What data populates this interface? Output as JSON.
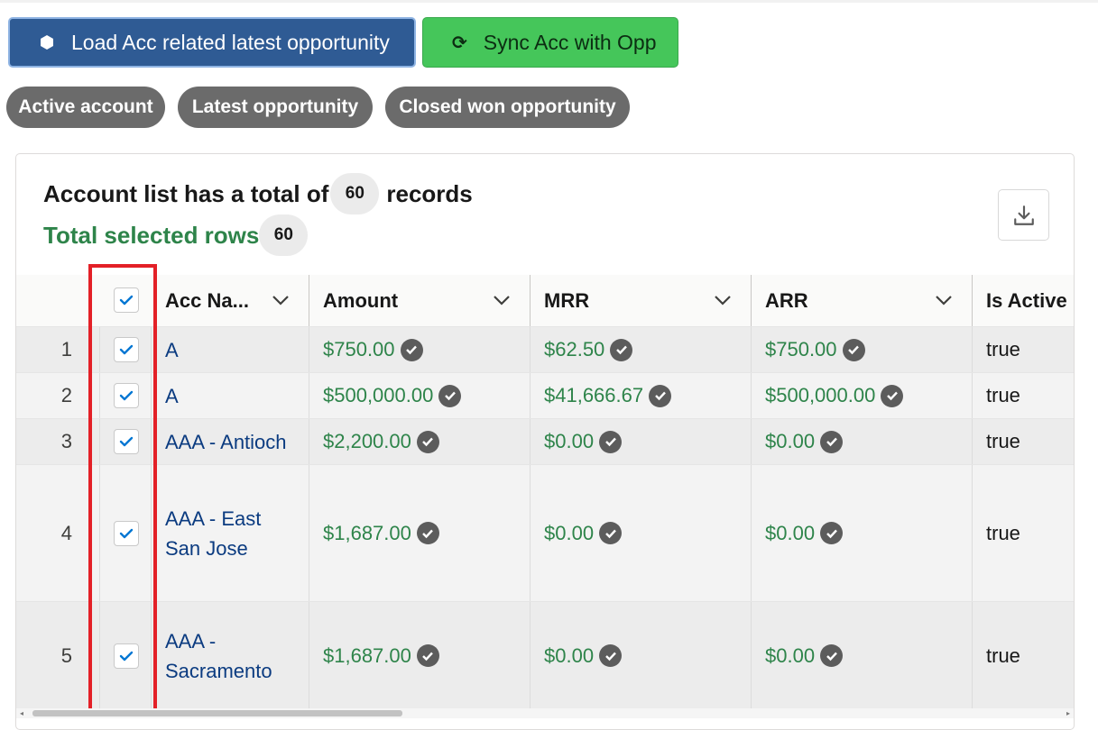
{
  "actions": {
    "load_label": "Load Acc related latest opportunity",
    "sync_label": "Sync Acc with Opp"
  },
  "filters": [
    "Active account",
    "Latest opportunity",
    "Closed won opportunity"
  ],
  "card": {
    "title_prefix": "Account list has a total of",
    "total_count": "60",
    "title_suffix": "records",
    "selected_label": "Total selected rows",
    "selected_count": "60",
    "download_icon": "download-icon"
  },
  "table": {
    "columns": [
      "Acc Na...",
      "Amount",
      "MRR",
      "ARR",
      "Is Active"
    ],
    "rows": [
      {
        "num": "1",
        "name": "A",
        "amount": "$750.00",
        "mrr": "$62.50",
        "arr": "$750.00",
        "active": "true",
        "selected": true
      },
      {
        "num": "2",
        "name": "A",
        "amount": "$500,000.00",
        "mrr": "$41,666.67",
        "arr": "$500,000.00",
        "active": "true",
        "selected": true
      },
      {
        "num": "3",
        "name": "AAA - Antioch",
        "amount": "$2,200.00",
        "mrr": "$0.00",
        "arr": "$0.00",
        "active": "true",
        "selected": true
      },
      {
        "num": "4",
        "name": "AAA - East San Jose",
        "amount": "$1,687.00",
        "mrr": "$0.00",
        "arr": "$0.00",
        "active": "true",
        "selected": true
      },
      {
        "num": "5",
        "name": "AAA - Sacramento",
        "amount": "$1,687.00",
        "mrr": "$0.00",
        "arr": "$0.00",
        "active": "true",
        "selected": true
      }
    ]
  },
  "colors": {
    "load_button": "#2f5b94",
    "sync_button": "#45c65a",
    "pill": "#6b6b6b",
    "money_green": "#2e844a",
    "link_blue": "#0b3b80",
    "highlight_red": "#e32027"
  }
}
